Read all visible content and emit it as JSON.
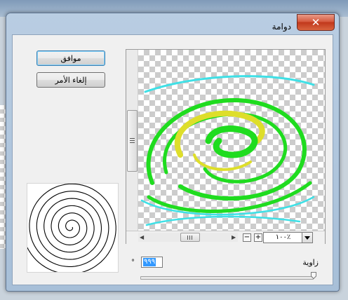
{
  "dialog": {
    "title": "دوامة",
    "close_icon": "close-icon"
  },
  "buttons": {
    "ok_label": "موافق",
    "cancel_label": "إلغاء الأمر"
  },
  "preview": {
    "zoom_level": "١٠٠٪"
  },
  "angle": {
    "label": "زاوية",
    "value": "٩٩٩",
    "unit": "°"
  },
  "colors": {
    "accent_cyan": "#3fe0e6",
    "accent_green": "#1fdc1f",
    "accent_yellow": "#dede2a",
    "close_red": "#c1381c"
  }
}
